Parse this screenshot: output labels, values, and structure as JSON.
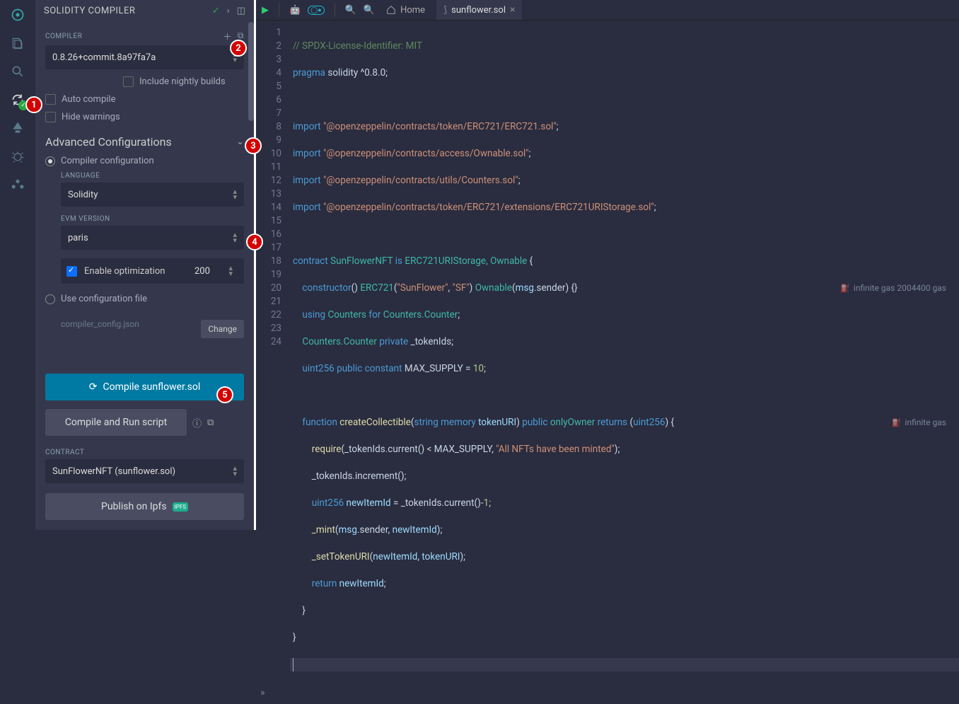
{
  "iconbar": {
    "items": [
      "logo",
      "files",
      "search",
      "compiler",
      "deploy",
      "debugger",
      "plugin"
    ]
  },
  "sidebar": {
    "title": "SOLIDITY COMPILER",
    "compiler_label": "COMPILER",
    "compiler_value": "0.8.26+commit.8a97fa7a",
    "include_nightly": "Include nightly builds",
    "auto_compile": "Auto compile",
    "hide_warnings": "Hide warnings",
    "adv_title": "Advanced Configurations",
    "radio_compiler_cfg": "Compiler configuration",
    "language_label": "LANGUAGE",
    "language_value": "Solidity",
    "evm_label": "EVM VERSION",
    "evm_value": "paris",
    "enable_opt": "Enable optimization",
    "opt_runs": "200",
    "radio_cfg_file": "Use configuration file",
    "cfg_filename": "compiler_config.json",
    "change_btn": "Change",
    "compile_btn": "Compile sunflower.sol",
    "compile_run_btn": "Compile and Run script",
    "contract_label": "CONTRACT",
    "contract_value": "SunFlowerNFT (sunflower.sol)",
    "publish_btn": "Publish on Ipfs"
  },
  "tabs": {
    "home": "Home",
    "file": "sunflower.sol"
  },
  "gas": {
    "line10": "infinite gas 2004400 gas",
    "line15": "infinite gas"
  },
  "code": {
    "l1": "// SPDX-License-Identifier: MIT",
    "l2a": "pragma",
    "l2b": " solidity ^0.8.0;",
    "imp": "import",
    "s4": "\"@openzeppelin/contracts/token/ERC721/ERC721.sol\"",
    "s5": "\"@openzeppelin/contracts/access/Ownable.sol\"",
    "s6": "\"@openzeppelin/contracts/utils/Counters.sol\"",
    "s7": "\"@openzeppelin/contracts/token/ERC721/extensions/ERC721URIStorage.sol\"",
    "contract": "contract",
    "is": "is",
    "name": "SunFlowerNFT",
    "base": "ERC721URIStorage, Ownable",
    "ctor": "constructor",
    "erc": "ERC721",
    "sf": "\"SunFlower\"",
    "sfs": "\"SF\"",
    "own": "Ownable",
    "msg": "msg",
    "sender": ".sender",
    "using": "using",
    "counters": "Counters",
    "for": "for",
    "cc": "Counters.Counter",
    "priv": "private",
    "tok": "_tokenIds",
    "uint": "uint256",
    "pub": "public",
    "const": "constant",
    "max": "MAX_SUPPLY",
    "ten": "10",
    "func": "function",
    "create": "createCollectible",
    "string": "string",
    "mem": "memory",
    "turi": "tokenURI",
    "onlyo": "onlyOwner",
    "ret": "returns",
    "req": "require",
    "cur": "_tokenIds.current",
    "lt": "<",
    "mint_err": "\"All NFTs have been minted\"",
    "inc": "_tokenIds.increment",
    "newid": "newItemId",
    "mint": "_mint",
    "seturi": "_setTokenURI",
    "return": "return"
  },
  "callouts": [
    "1",
    "2",
    "3",
    "4",
    "5"
  ]
}
